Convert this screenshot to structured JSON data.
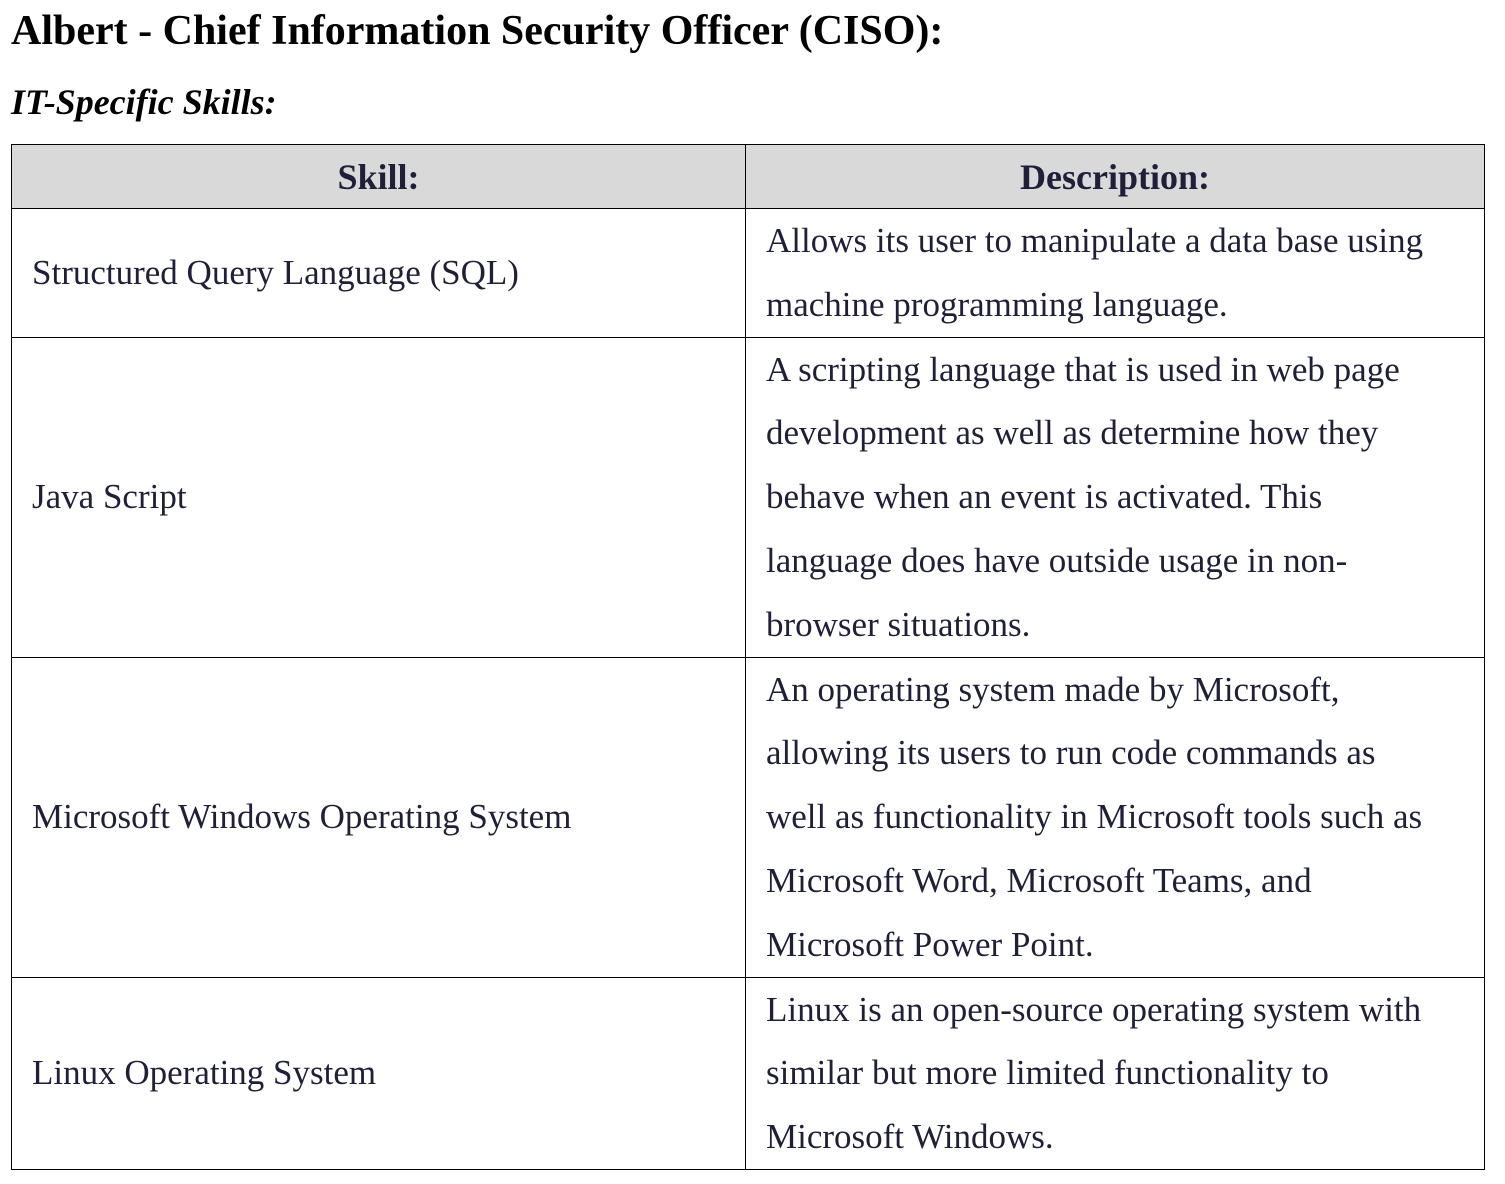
{
  "document": {
    "title": "Albert - Chief Information Security Officer (CISO):",
    "subtitle": "IT-Specific Skills:"
  },
  "table": {
    "headers": [
      "Skill:",
      "Description:"
    ],
    "rows": [
      {
        "skill": "Structured Query Language (SQL)",
        "description_lines": [
          "Allows its user to manipulate a data base using",
          "machine programming language."
        ]
      },
      {
        "skill": "Java Script",
        "description_lines": [
          "A scripting language that is used in web page",
          "development as well as determine how they",
          "behave when an event is activated. This",
          "language does have outside usage in non-",
          "browser situations."
        ]
      },
      {
        "skill": "Microsoft Windows Operating System",
        "description_lines": [
          "An operating system made by Microsoft,",
          "allowing its users to run code commands as",
          "well as functionality in Microsoft tools such as",
          "Microsoft Word, Microsoft Teams, and",
          "Microsoft Power Point."
        ]
      },
      {
        "skill": "Linux Operating System",
        "description_lines": [
          "Linux is an open-source operating system with",
          "similar but more limited functionality to",
          "Microsoft Windows."
        ]
      }
    ]
  }
}
